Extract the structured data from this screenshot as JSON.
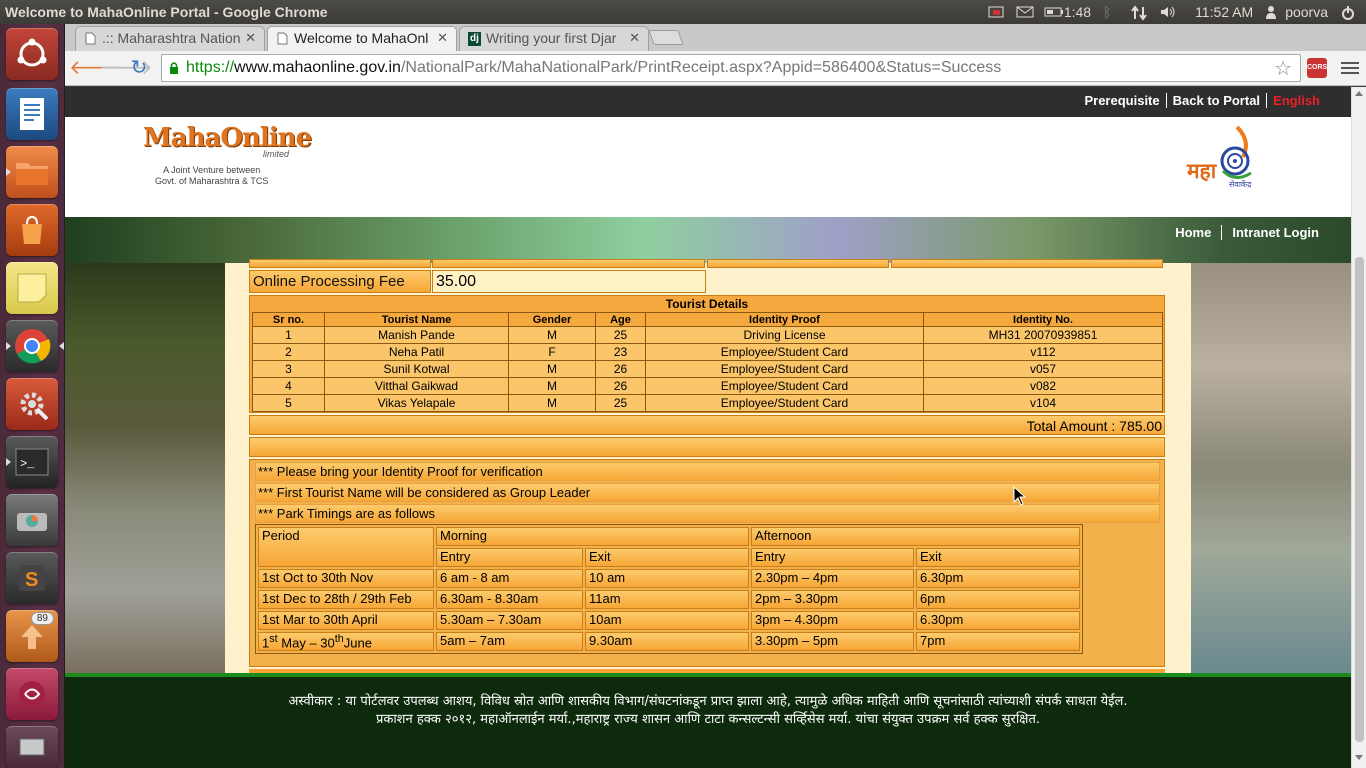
{
  "os_panel": {
    "window_title": "Welcome to MahaOnline Portal - Google Chrome",
    "battery_time": "1:48",
    "clock": "11:52 AM",
    "user": "poorva"
  },
  "launcher": {
    "badge_count": "89"
  },
  "browser": {
    "tabs": [
      {
        "label": ".:: Maharashtra Nation",
        "active": false
      },
      {
        "label": "Welcome to MahaOnl",
        "active": true
      },
      {
        "label": "Writing your first Djar",
        "active": false
      }
    ],
    "url_scheme": "https://",
    "url_host": "www.mahaonline.gov.in",
    "url_path": "/NationalPark/MahaNationalPark/PrintReceipt.aspx?Appid=586400&Status=Success",
    "cors_label": "CORS"
  },
  "site": {
    "top_links": [
      "Prerequisite",
      "Back to Portal",
      "English"
    ],
    "logo_name": "MahaOnline",
    "logo_limited": "limited",
    "logo_sub_line1": "A Joint Venture between",
    "logo_sub_line2": "Govt. of Maharashtra & TCS",
    "seva_logo_text": "महा",
    "seva_logo_sub": "सेवाकेंद्र",
    "nav_links": [
      "Home",
      "Intranet Login"
    ]
  },
  "receipt": {
    "fee_label": "Online Processing Fee",
    "fee_value": "35.00",
    "tourist_title": "Tourist Details",
    "tourist_headers": [
      "Sr no.",
      "Tourist Name",
      "Gender",
      "Age",
      "Identity Proof",
      "Identity No."
    ],
    "tourists": [
      [
        "1",
        "Manish Pande",
        "M",
        "25",
        "Driving License",
        "MH31 20070939851"
      ],
      [
        "2",
        "Neha Patil",
        "F",
        "23",
        "Employee/Student Card",
        "v112"
      ],
      [
        "3",
        "Sunil Kotwal",
        "M",
        "26",
        "Employee/Student Card",
        "v057"
      ],
      [
        "4",
        "Vitthal Gaikwad",
        "M",
        "26",
        "Employee/Student Card",
        "v082"
      ],
      [
        "5",
        "Vikas Yelapale",
        "M",
        "25",
        "Employee/Student Card",
        "v104"
      ]
    ],
    "total": "Total Amount : 785.00",
    "notes": [
      "*** Please bring your Identity Proof for verification",
      "*** First Tourist Name will be considered as Group Leader",
      "*** Park Timings are as follows"
    ],
    "timings": {
      "period_label": "Period",
      "morning_label": "Morning",
      "afternoon_label": "Afternoon",
      "entry_label": "Entry",
      "exit_label": "Exit",
      "rows": [
        [
          "1st Oct to 30th Nov",
          "6 am - 8 am",
          "10 am",
          "2.30pm – 4pm",
          "6.30pm"
        ],
        [
          "1st Dec to 28th / 29th Feb",
          "6.30am - 8.30am",
          "11am",
          "2pm – 3.30pm",
          "6pm"
        ],
        [
          "1st Mar to 30th April",
          "5.30am – 7.30am",
          "10am",
          "3pm – 4.30pm",
          "6.30pm"
        ]
      ],
      "last_row": {
        "period_pre": "1",
        "period_sup1": "st",
        "period_mid": " May – 30",
        "period_sup2": "th",
        "period_post": "June",
        "m_entry": "5am – 7am",
        "m_exit": "9.30am",
        "a_entry": "3.30pm – 5pm",
        "a_exit": "7pm"
      }
    }
  },
  "footer": {
    "line1": "अस्वीकार : या पोर्टलवर उपलब्ध आशय, विविध स्रोत आणि शासकीय विभाग/संघटनांकडून प्राप्त झाला आहे, त्यामुळे अधिक माहिती आणि सूचनांसाठी त्यांच्याशी संपर्क साधता येईल.",
    "line2": "प्रकाशन हक्क २०१२, महाऑनलाईन मर्या.,महाराष्ट्र राज्य शासन आणि टाटा कन्सल्टन्सी सर्व्हिसेस मर्या. यांचा संयुक्त उपक्रम सर्व हक्क सुरक्षित."
  },
  "colors": {
    "panel_orange": "#f7a636",
    "footer_green": "#0d2a0d",
    "lang_red": "#e8202a",
    "launcher_purple": "#5c3147"
  }
}
